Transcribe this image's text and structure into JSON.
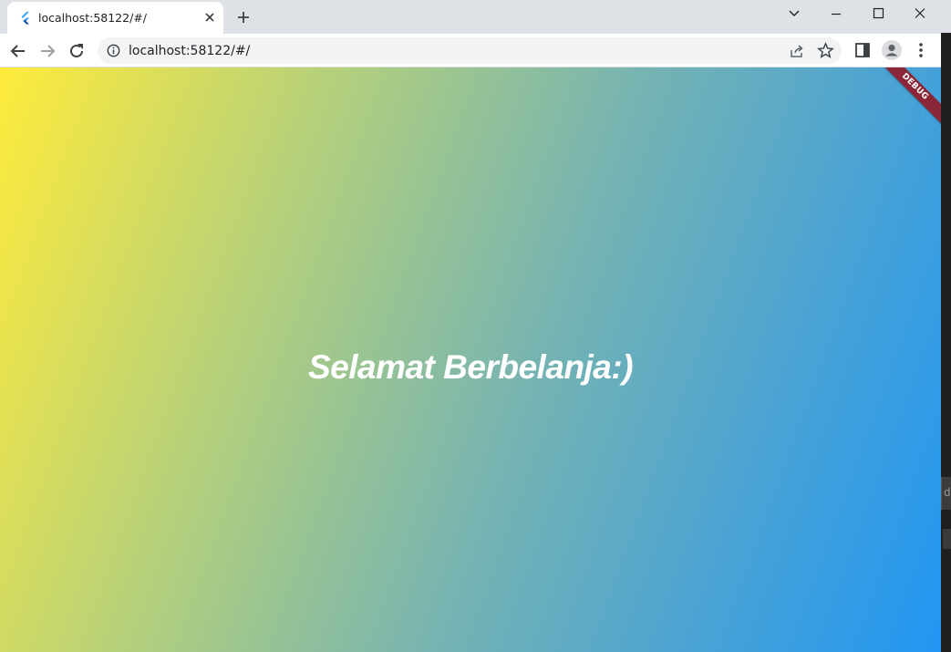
{
  "browser": {
    "tab": {
      "title": "localhost:58122/#/",
      "favicon": "flutter-icon"
    },
    "address_bar": {
      "url": "localhost:58122/#/"
    },
    "icons": [
      "back-icon",
      "forward-icon",
      "reload-icon",
      "info-icon",
      "share-icon",
      "star-icon",
      "side-panel-icon",
      "profile-icon",
      "menu-icon",
      "new-tab-icon",
      "tab-search-icon",
      "minimize-icon",
      "maximize-icon",
      "close-icon"
    ]
  },
  "app": {
    "welcome_text": "Selamat Berbelanja:)",
    "debug_banner": "DEBUG",
    "gradient": [
      "#ffeb3b",
      "#2196f3"
    ]
  }
}
